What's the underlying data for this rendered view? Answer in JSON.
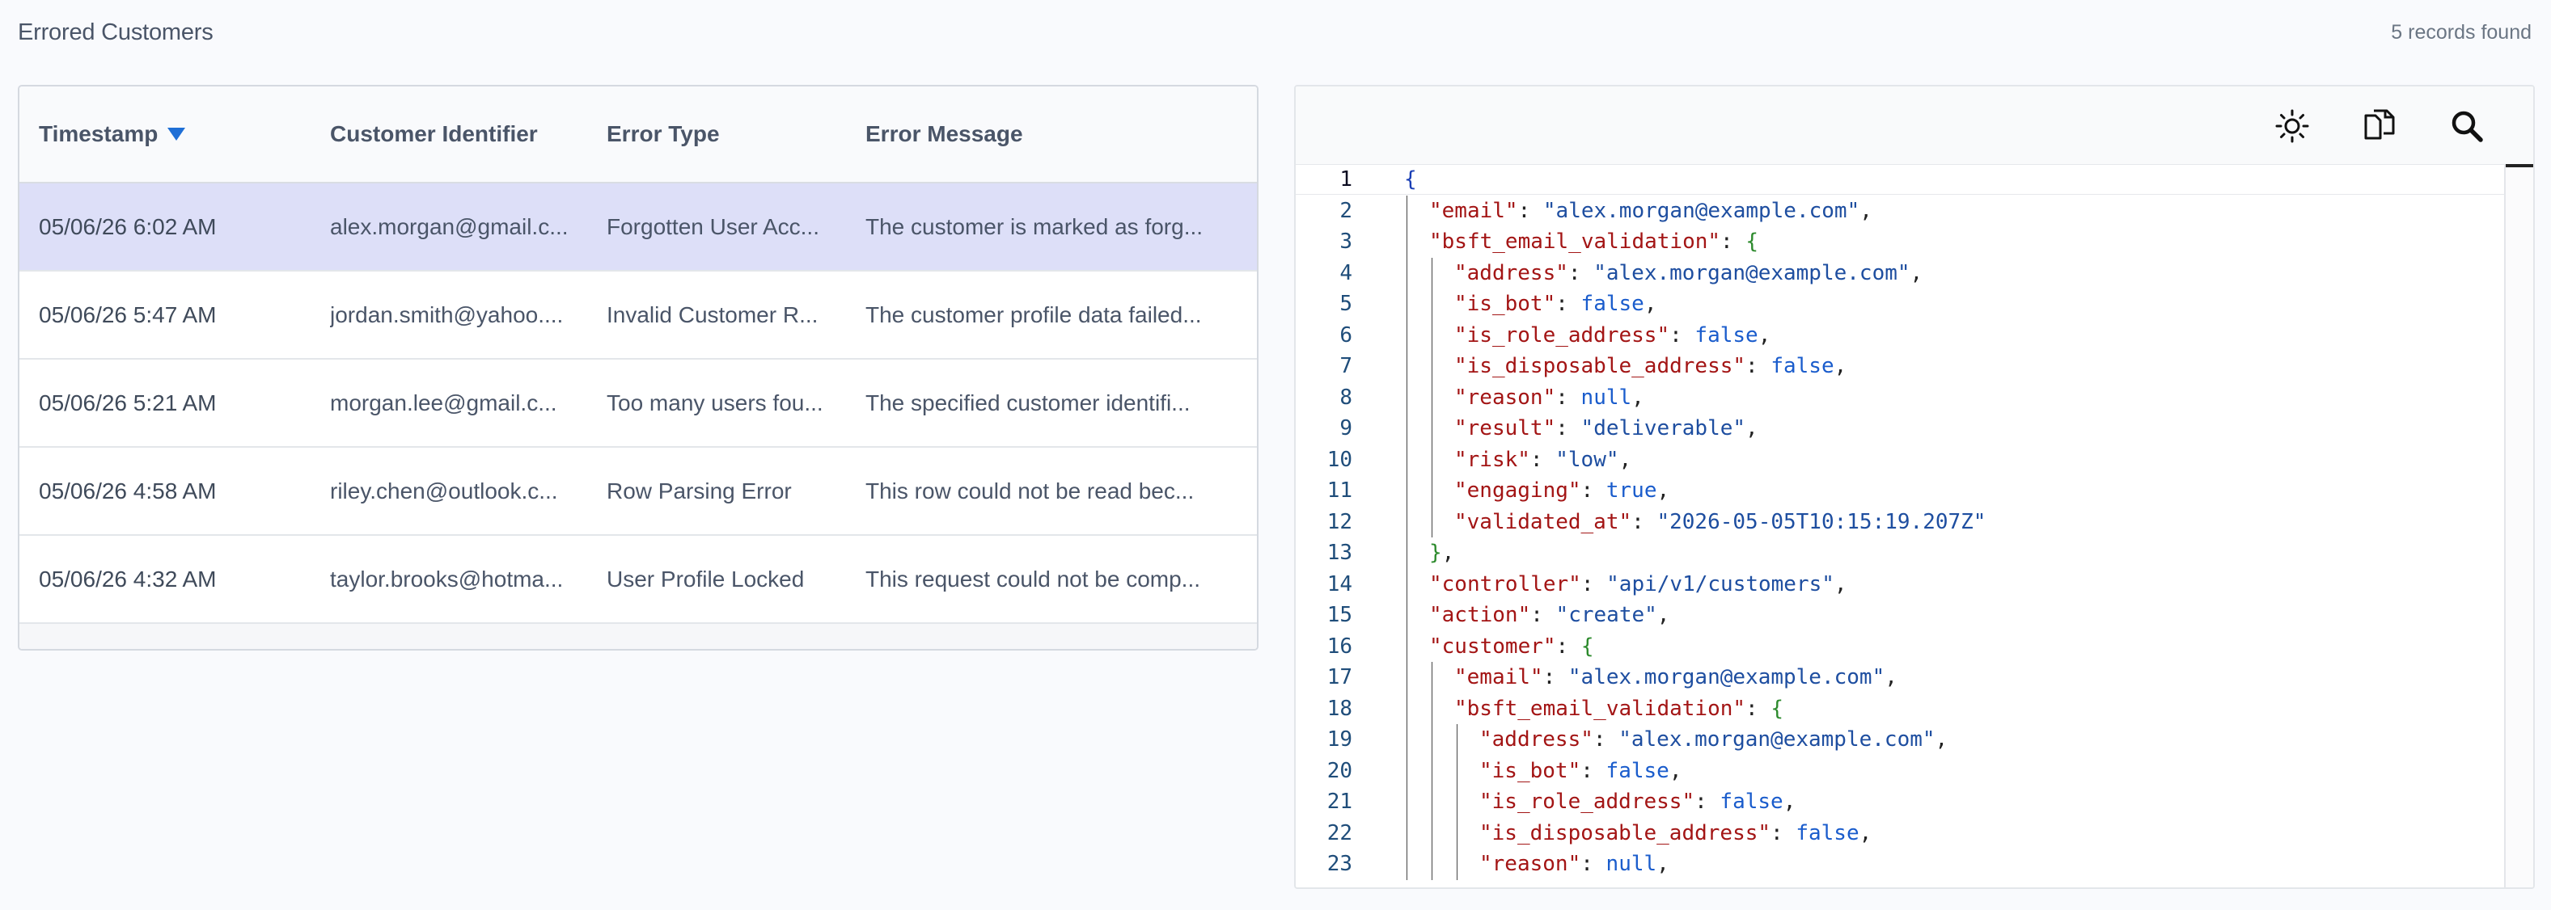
{
  "page": {
    "title": "Errored Customers",
    "record_count": "5 records found"
  },
  "table": {
    "columns": [
      "Timestamp",
      "Customer Identifier",
      "Error Type",
      "Error Message"
    ],
    "sort_column": "Timestamp",
    "sort_direction": "descending",
    "rows": [
      {
        "timestamp": "05/06/26 6:02 AM",
        "customer": "alex.morgan@gmail.c...",
        "error_type": "Forgotten User Acc...",
        "message": "The customer is marked as forg...",
        "selected": true
      },
      {
        "timestamp": "05/06/26 5:47 AM",
        "customer": "jordan.smith@yahoo....",
        "error_type": "Invalid Customer R...",
        "message": "The customer profile data failed...",
        "selected": false
      },
      {
        "timestamp": "05/06/26 5:21 AM",
        "customer": "morgan.lee@gmail.c...",
        "error_type": "Too many users fou...",
        "message": "The specified customer identifi...",
        "selected": false
      },
      {
        "timestamp": "05/06/26 4:58 AM",
        "customer": "riley.chen@outlook.c...",
        "error_type": "Row Parsing Error",
        "message": "This row could not be read bec...",
        "selected": false
      },
      {
        "timestamp": "05/06/26 4:32 AM",
        "customer": "taylor.brooks@hotma...",
        "error_type": "User Profile Locked",
        "message": "This request could not be comp...",
        "selected": false
      }
    ]
  },
  "json_viewer": {
    "toolbar": {
      "theme_icon": "sun-icon",
      "copy_icon": "copy-icon",
      "search_icon": "search-icon"
    },
    "active_line": 1,
    "lines": [
      {
        "n": "1",
        "indent": 0,
        "tokens": [
          [
            "brace-root",
            "{"
          ]
        ]
      },
      {
        "n": "2",
        "indent": 1,
        "tokens": [
          [
            "k",
            "\"email\""
          ],
          [
            "p",
            ": "
          ],
          [
            "s",
            "\"alex.morgan@example.com\""
          ],
          [
            "p",
            ","
          ]
        ]
      },
      {
        "n": "3",
        "indent": 1,
        "tokens": [
          [
            "k",
            "\"bsft_email_validation\""
          ],
          [
            "p",
            ": "
          ],
          [
            "brace-g",
            "{"
          ]
        ]
      },
      {
        "n": "4",
        "indent": 2,
        "tokens": [
          [
            "k",
            "\"address\""
          ],
          [
            "p",
            ": "
          ],
          [
            "s",
            "\"alex.morgan@example.com\""
          ],
          [
            "p",
            ","
          ]
        ]
      },
      {
        "n": "5",
        "indent": 2,
        "tokens": [
          [
            "k",
            "\"is_bot\""
          ],
          [
            "p",
            ": "
          ],
          [
            "b",
            "false"
          ],
          [
            "p",
            ","
          ]
        ]
      },
      {
        "n": "6",
        "indent": 2,
        "tokens": [
          [
            "k",
            "\"is_role_address\""
          ],
          [
            "p",
            ": "
          ],
          [
            "b",
            "false"
          ],
          [
            "p",
            ","
          ]
        ]
      },
      {
        "n": "7",
        "indent": 2,
        "tokens": [
          [
            "k",
            "\"is_disposable_address\""
          ],
          [
            "p",
            ": "
          ],
          [
            "b",
            "false"
          ],
          [
            "p",
            ","
          ]
        ]
      },
      {
        "n": "8",
        "indent": 2,
        "tokens": [
          [
            "k",
            "\"reason\""
          ],
          [
            "p",
            ": "
          ],
          [
            "b",
            "null"
          ],
          [
            "p",
            ","
          ]
        ]
      },
      {
        "n": "9",
        "indent": 2,
        "tokens": [
          [
            "k",
            "\"result\""
          ],
          [
            "p",
            ": "
          ],
          [
            "s",
            "\"deliverable\""
          ],
          [
            "p",
            ","
          ]
        ]
      },
      {
        "n": "10",
        "indent": 2,
        "tokens": [
          [
            "k",
            "\"risk\""
          ],
          [
            "p",
            ": "
          ],
          [
            "s",
            "\"low\""
          ],
          [
            "p",
            ","
          ]
        ]
      },
      {
        "n": "11",
        "indent": 2,
        "tokens": [
          [
            "k",
            "\"engaging\""
          ],
          [
            "p",
            ": "
          ],
          [
            "b",
            "true"
          ],
          [
            "p",
            ","
          ]
        ]
      },
      {
        "n": "12",
        "indent": 2,
        "tokens": [
          [
            "k",
            "\"validated_at\""
          ],
          [
            "p",
            ": "
          ],
          [
            "s",
            "\"2026-05-05T10:15:19.207Z\""
          ]
        ]
      },
      {
        "n": "13",
        "indent": 1,
        "tokens": [
          [
            "brace-g",
            "}"
          ],
          [
            "p",
            ","
          ]
        ]
      },
      {
        "n": "14",
        "indent": 1,
        "tokens": [
          [
            "k",
            "\"controller\""
          ],
          [
            "p",
            ": "
          ],
          [
            "s",
            "\"api/v1/customers\""
          ],
          [
            "p",
            ","
          ]
        ]
      },
      {
        "n": "15",
        "indent": 1,
        "tokens": [
          [
            "k",
            "\"action\""
          ],
          [
            "p",
            ": "
          ],
          [
            "s",
            "\"create\""
          ],
          [
            "p",
            ","
          ]
        ]
      },
      {
        "n": "16",
        "indent": 1,
        "tokens": [
          [
            "k",
            "\"customer\""
          ],
          [
            "p",
            ": "
          ],
          [
            "brace-g",
            "{"
          ]
        ]
      },
      {
        "n": "17",
        "indent": 2,
        "tokens": [
          [
            "k",
            "\"email\""
          ],
          [
            "p",
            ": "
          ],
          [
            "s",
            "\"alex.morgan@example.com\""
          ],
          [
            "p",
            ","
          ]
        ]
      },
      {
        "n": "18",
        "indent": 2,
        "tokens": [
          [
            "k",
            "\"bsft_email_validation\""
          ],
          [
            "p",
            ": "
          ],
          [
            "brace-g",
            "{"
          ]
        ]
      },
      {
        "n": "19",
        "indent": 3,
        "tokens": [
          [
            "k",
            "\"address\""
          ],
          [
            "p",
            ": "
          ],
          [
            "s",
            "\"alex.morgan@example.com\""
          ],
          [
            "p",
            ","
          ]
        ]
      },
      {
        "n": "20",
        "indent": 3,
        "tokens": [
          [
            "k",
            "\"is_bot\""
          ],
          [
            "p",
            ": "
          ],
          [
            "b",
            "false"
          ],
          [
            "p",
            ","
          ]
        ]
      },
      {
        "n": "21",
        "indent": 3,
        "tokens": [
          [
            "k",
            "\"is_role_address\""
          ],
          [
            "p",
            ": "
          ],
          [
            "b",
            "false"
          ],
          [
            "p",
            ","
          ]
        ]
      },
      {
        "n": "22",
        "indent": 3,
        "tokens": [
          [
            "k",
            "\"is_disposable_address\""
          ],
          [
            "p",
            ": "
          ],
          [
            "b",
            "false"
          ],
          [
            "p",
            ","
          ]
        ]
      },
      {
        "n": "23",
        "indent": 3,
        "tokens": [
          [
            "k",
            "\"reason\""
          ],
          [
            "p",
            ": "
          ],
          [
            "b",
            "null"
          ],
          [
            "p",
            ","
          ]
        ]
      }
    ]
  },
  "colors": {
    "selected_row": "#dddff8",
    "sort_arrow": "#1f6fd6",
    "json_key": "#a31515",
    "json_string": "#1e4ea0",
    "json_literal": "#1a5ccc"
  }
}
